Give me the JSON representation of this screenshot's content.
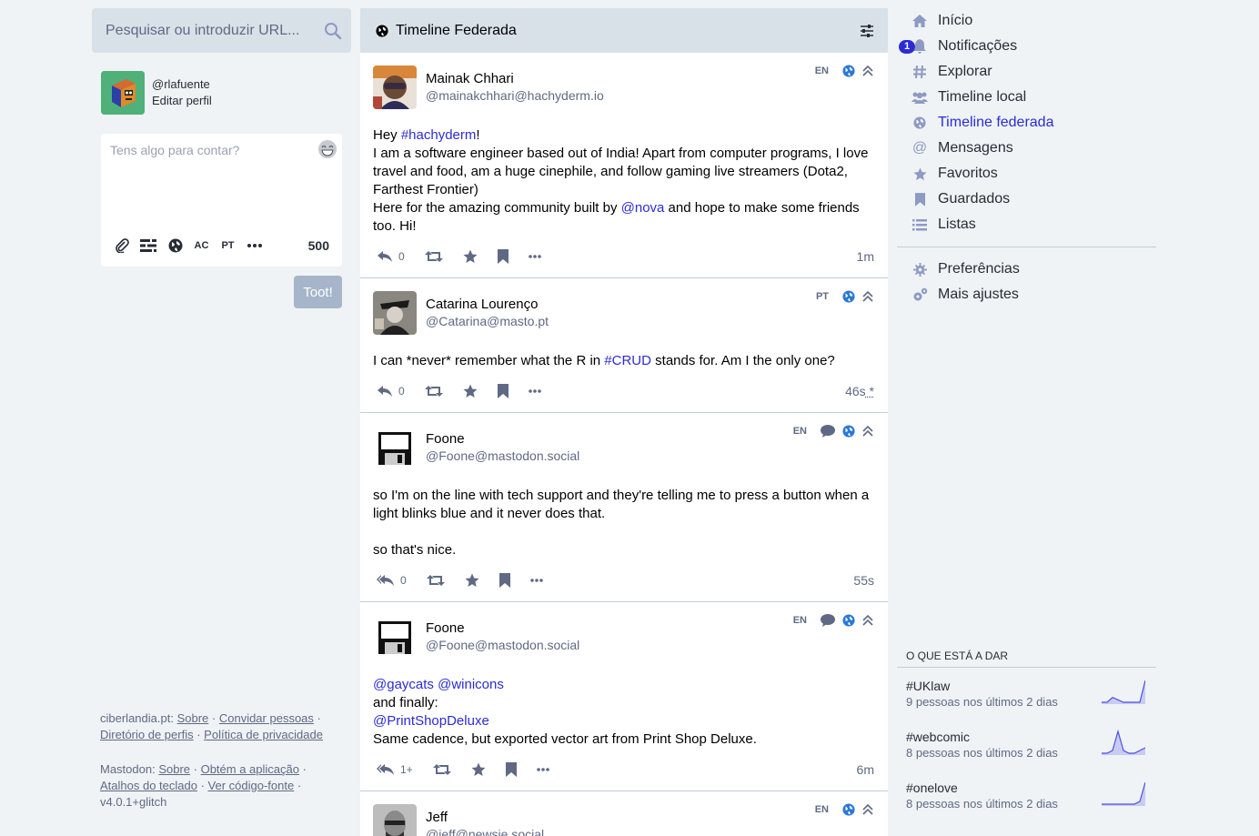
{
  "search": {
    "placeholder": "Pesquisar ou introduzir URL..."
  },
  "account": {
    "handle": "@rlafuente",
    "edit_label": "Editar perfil"
  },
  "compose": {
    "placeholder": "Tens algo para contar?",
    "lang_ac": "AC",
    "lang_pt": "PT",
    "counter": "500",
    "submit_label": "Toot!"
  },
  "left_footer": {
    "site": "ciberlandia.pt:",
    "about": "Sobre",
    "invite": "Convidar pessoas",
    "directory": "Diretório de perfis",
    "privacy": "Política de privacidade",
    "mastodon": "Mastodon:",
    "about2": "Sobre",
    "get_app": "Obtém a aplicação",
    "shortcuts": "Atalhos do teclado",
    "source": "Ver código-fonte",
    "version": "v4.0.1+glitch"
  },
  "column": {
    "title": "Timeline Federada"
  },
  "statuses": [
    {
      "display_name": "Mainak Chhari",
      "acct": "@mainakchhari@hachyderm.io",
      "lang": "EN",
      "line1_pre": "Hey ",
      "line1_tag": "#hachyderm",
      "line1_post": "!",
      "line2": "I am a software engineer based out of India! Apart from computer programs, I love travel and food, am a huge cinephile, and follow gaming live streamers (Dota2, Farthest Frontier)",
      "line3_pre": "Here for the amazing community built by ",
      "line3_mention": "@nova",
      "line3_post": " and hope to make some friends too. Hi!",
      "replies": "0",
      "time": "1m"
    },
    {
      "display_name": "Catarina Lourenço",
      "acct": "@Catarina@masto.pt",
      "lang": "PT",
      "text_pre": "I can *never* remember what the R in ",
      "text_tag": "#CRUD",
      "text_post": " stands for. Am I the only one?",
      "replies": "0",
      "time": "46s",
      "edited_mark": " *"
    },
    {
      "display_name": "Foone",
      "acct": "@Foone@mastodon.social",
      "lang": "EN",
      "p1": "so I'm on the line with tech support and they're telling me to press a button when a light blinks blue and it never does that.",
      "p2": "so that's nice.",
      "replies": "0",
      "time": "55s"
    },
    {
      "display_name": "Foone",
      "acct": "@Foone@mastodon.social",
      "lang": "EN",
      "m1": "@gaycats",
      "m2": "@winicons",
      "l2": "and finally:",
      "m3": "@PrintShopDeluxe",
      "l4": "Same cadence, but exported vector art from Print Shop Deluxe.",
      "replies": "1+",
      "time": "6m"
    },
    {
      "display_name": "Jeff",
      "acct": "@jeff@newsie.social",
      "lang": "EN"
    }
  ],
  "nav": {
    "home": "Início",
    "notifications": "Notificações",
    "notifications_badge": "1",
    "explore": "Explorar",
    "local": "Timeline local",
    "federated": "Timeline federada",
    "messages": "Mensagens",
    "favourites": "Favoritos",
    "bookmarks": "Guardados",
    "lists": "Listas",
    "preferences": "Preferências",
    "more_settings": "Mais ajustes"
  },
  "trends": {
    "title": "O QUE ESTÁ A DAR",
    "items": [
      {
        "tag": "#UKlaw",
        "uses": "9 pessoas nos últimos 2 dias",
        "history": [
          0,
          0,
          2,
          1,
          0,
          0,
          0,
          0,
          9
        ]
      },
      {
        "tag": "#webcomic",
        "uses": "8 pessoas nos últimos 2 dias",
        "history": [
          0,
          0,
          1,
          8,
          1,
          0,
          0,
          1,
          2
        ]
      },
      {
        "tag": "#onelove",
        "uses": "8 pessoas nos últimos 2 dias",
        "history": [
          0,
          0,
          0,
          0,
          0,
          0,
          0,
          1,
          8
        ]
      }
    ]
  },
  "colors": {
    "accent": "#2b2bd6",
    "muted": "#606984",
    "header": "#d9e1e8",
    "background": "#eff3f5",
    "action_icon": "#606984"
  }
}
